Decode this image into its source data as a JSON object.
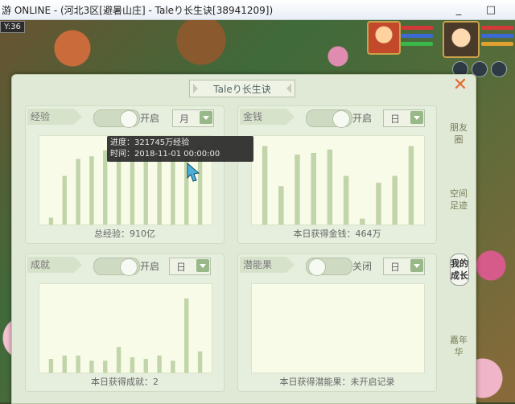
{
  "window": {
    "title": "游 ONLINE - (河北3区[避暑山庄] - Taleり长生诀[38941209])",
    "minimize_label": "_",
    "maximize_label": "□",
    "coord_readout": "Y:36"
  },
  "panel": {
    "title": "Taleり长生诀",
    "close_label": "✕",
    "side_tabs": [
      {
        "label": "朋友圈",
        "active": false
      },
      {
        "label": "空间足迹",
        "active": false
      },
      {
        "label": "我的成长",
        "active": true
      },
      {
        "label": "嘉年华",
        "active": false
      }
    ]
  },
  "cards": [
    {
      "label": "经验",
      "toggle_label": "开启",
      "toggle_on": true,
      "period": "月",
      "footer": "总经验：910亿"
    },
    {
      "label": "金钱",
      "toggle_label": "开启",
      "toggle_on": true,
      "period": "日",
      "footer": "本日获得金钱：464万"
    },
    {
      "label": "成就",
      "toggle_label": "开启",
      "toggle_on": true,
      "period": "日",
      "footer": "本日获得成就：2"
    },
    {
      "label": "潜能果",
      "toggle_label": "关闭",
      "toggle_on": false,
      "period": "日",
      "footer": "本日获得潜能果：未开启记录"
    }
  ],
  "tooltip": {
    "line1": "进度：321745万经验",
    "line2": "时间：2018-11-01 00:00:00"
  },
  "colors": {
    "bar": "#c2d4a9",
    "close": "#e86a32",
    "plot_bg": "#f7fbe8"
  },
  "chart_data": [
    {
      "type": "bar",
      "series_name": "经验",
      "values": [
        0.08,
        0.57,
        0.77,
        0.8,
        0.87,
        0.88,
        0.88,
        0.88,
        0.88,
        0.9,
        0.9,
        0.92
      ],
      "ylim": [
        0,
        1
      ]
    },
    {
      "type": "bar",
      "series_name": "金钱",
      "values": [
        0.92,
        0.45,
        0.82,
        0.84,
        0.88,
        0.57,
        0.07,
        0.49,
        0.57,
        0.92
      ],
      "ylim": [
        0,
        1
      ]
    },
    {
      "type": "bar",
      "series_name": "成就",
      "values": [
        0.16,
        0.2,
        0.2,
        0.14,
        0.14,
        0.3,
        0.18,
        0.16,
        0.2,
        0.14,
        0.87,
        0.25
      ],
      "ylim": [
        0,
        1
      ]
    },
    {
      "type": "bar",
      "series_name": "潜能果",
      "values": [],
      "ylim": [
        0,
        1
      ]
    }
  ]
}
